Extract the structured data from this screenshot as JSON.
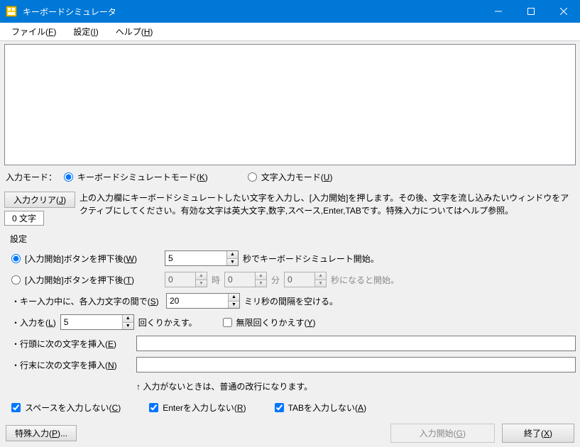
{
  "window": {
    "title": "キーボードシミュレータ"
  },
  "menu": {
    "file": "ファイル(F)",
    "settings": "設定(I)",
    "help": "ヘルプ(H)"
  },
  "textarea": {
    "value": ""
  },
  "mode": {
    "label": "入力モード：",
    "simulate": "キーボードシミュレートモード(K)",
    "charinput": "文字入力モード(U)"
  },
  "clear_button": "入力クリア(J)",
  "counter": "0 文字",
  "help_text": "上の入力欄にキーボードシミュレートしたい文字を入力し、[入力開始]を押します。その後、文字を流し込みたいウィンドウをアクティブにしてください。有効な文字は英大文字,数字,スペース,Enter,TABです。特殊入力についてはヘルプ参照。",
  "settings": {
    "header": "設定",
    "after_press_sec_label": "[入力開始]ボタンを押下後(W)",
    "after_press_sec_value": "5",
    "after_press_sec_suffix": "秒でキーボードシミュレート開始。",
    "after_press_time_label": "[入力開始]ボタンを押下後(T)",
    "time_hour": "0",
    "time_hour_label": "時",
    "time_min": "0",
    "time_min_label": "分",
    "time_sec": "0",
    "time_sec_suffix": "秒になると開始。",
    "interval_label": "・キー入力中に、各入力文字の間で(S)",
    "interval_value": "20",
    "interval_suffix": "ミリ秒の間隔を空ける。",
    "repeat_label": "・入力を(L)",
    "repeat_value": "5",
    "repeat_suffix": "回くりかえす。",
    "infinite_repeat": "無限回くりかえす(Y)",
    "prefix_label": "・行頭に次の文字を挿入(E)",
    "prefix_value": "",
    "suffix_label": "・行末に次の文字を挿入(N)",
    "suffix_value": "",
    "hint": "↑ 入力がないときは、普通の改行になります。",
    "skip_space": "スペースを入力しない(C)",
    "skip_enter": "Enterを入力しない(R)",
    "skip_tab": "TABを入力しない(A)"
  },
  "buttons": {
    "special": "特殊入力(P)...",
    "start": "入力開始(G)",
    "exit": "終了(X)"
  }
}
